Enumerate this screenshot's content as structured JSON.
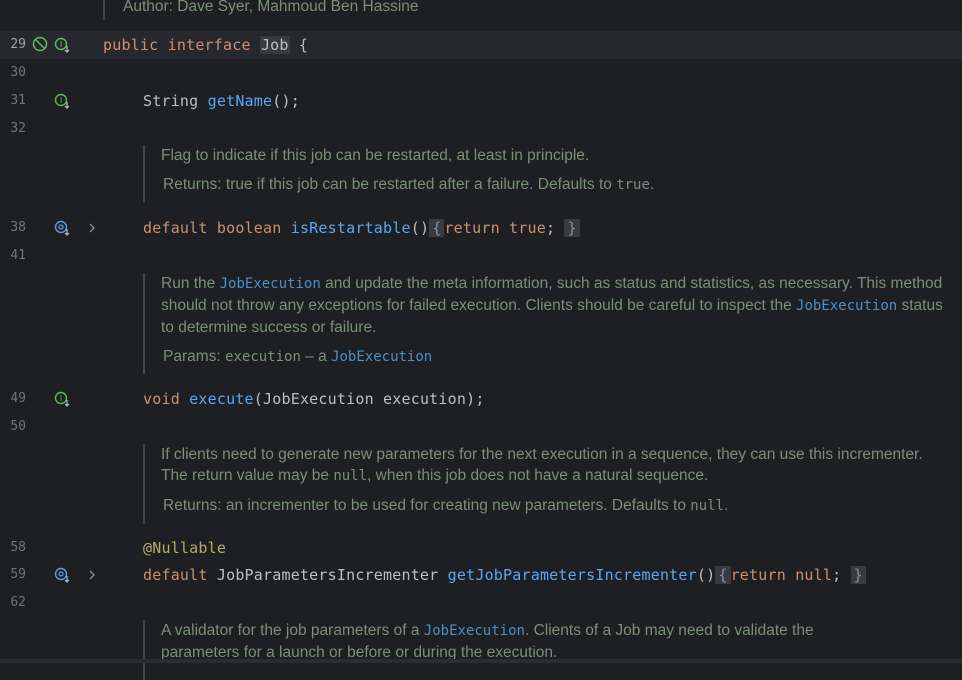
{
  "author_line": "Author: Dave Syer, Mahmoud Ben Hassine",
  "lines": {
    "l29": {
      "num": "29",
      "public": "public",
      "interface": "interface",
      "name": "Job",
      "brace": " {"
    },
    "l30": {
      "num": "30"
    },
    "l31": {
      "num": "31",
      "type": "String",
      "method": "getName",
      "rest": "();"
    },
    "l32": {
      "num": "32"
    },
    "l38": {
      "num": "38",
      "default": "default",
      "boolean": "boolean",
      "method": "isRestartable",
      "parens": "()",
      "fold_open": "{",
      "return": "return",
      "true": "true",
      "semi": ";",
      "fold_close": "}"
    },
    "l41": {
      "num": "41"
    },
    "l49": {
      "num": "49",
      "void": "void",
      "method": "execute",
      "rest": "(JobExecution execution);"
    },
    "l50": {
      "num": "50"
    },
    "l58": {
      "num": "58",
      "annotation": "@Nullable"
    },
    "l59": {
      "num": "59",
      "default": "default",
      "type": "JobParametersIncrementer",
      "method": "getJobParametersIncrementer",
      "parens": "()",
      "fold_open": "{",
      "return": "return",
      "null": "null",
      "semi": ";",
      "fold_close": "}"
    },
    "l62": {
      "num": "62"
    }
  },
  "docs": {
    "restartable": {
      "text": "Flag to indicate if this job can be restarted, at least in principle.",
      "returns_label": "Returns:",
      "returns_text": "true if this job can be restarted after a failure. Defaults to",
      "returns_code": "true",
      "returns_end": "."
    },
    "execute": {
      "t1": "Run the",
      "link1": "JobExecution",
      "t2": "and update the meta information, such as status and statistics, as necessary. This method should not throw any exceptions for failed execution. Clients should be careful to inspect the",
      "link2": "JobExecution",
      "t3": "status to determine success or failure.",
      "params_label": "Params:",
      "params_code": "execution",
      "params_dash": "– a",
      "params_link": "JobExecution"
    },
    "incrementer": {
      "t1": "If clients need to generate new parameters for the next execution in a sequence, they can use this incrementer. The return value may be",
      "code1": "null",
      "t2": ", when this job does not have a natural sequence.",
      "returns_label": "Returns:",
      "returns_text": "an incrementer to be used for creating new parameters. Defaults to",
      "returns_code": "null",
      "returns_end": "."
    },
    "validator": {
      "t1": "A validator for the job parameters of a",
      "link1": "JobExecution",
      "t2": ". Clients of a Job may need to validate the",
      "t3": "parameters for a launch or before or during the execution."
    }
  },
  "colors": {
    "background": "#1e1f22",
    "keyword": "#cf8e6d",
    "function": "#56a8f5",
    "doc": "#7a8f78",
    "link": "#4b8fc7",
    "annotation": "#b3ae60",
    "impl_icon": "#5fb85f",
    "override_icon": "#5c9ce6"
  },
  "icons": [
    "no-breakpoint-icon",
    "implemented-icon",
    "overridden-icon",
    "fold-chevron-icon"
  ]
}
